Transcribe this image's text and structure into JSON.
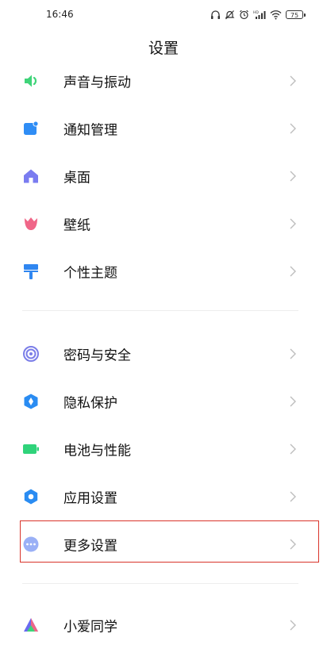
{
  "status_bar": {
    "time": "16:46",
    "battery_level": "75"
  },
  "page": {
    "title": "设置"
  },
  "groups": [
    [
      {
        "label": "声音与振动",
        "icon": "speaker-icon",
        "color": "#3fd479"
      },
      {
        "label": "通知管理",
        "icon": "notification-icon",
        "color": "#2f8df5"
      },
      {
        "label": "桌面",
        "icon": "home-icon",
        "color": "#7a7cf0"
      },
      {
        "label": "壁纸",
        "icon": "tulip-icon",
        "color": "#f06688"
      },
      {
        "label": "个性主题",
        "icon": "paint-roller-icon",
        "color": "#2f86f0"
      }
    ],
    [
      {
        "label": "密码与安全",
        "icon": "fingerprint-icon",
        "color": "#7b7ee8"
      },
      {
        "label": "隐私保护",
        "icon": "privacy-shield-icon",
        "color": "#2a8cf2"
      },
      {
        "label": "电池与性能",
        "icon": "battery-icon",
        "color": "#2fd37a"
      },
      {
        "label": "应用设置",
        "icon": "gear-icon",
        "color": "#2a8cf2"
      },
      {
        "label": "更多设置",
        "icon": "more-dots-icon",
        "color": "#9ab0f6"
      }
    ],
    [
      {
        "label": "小爱同学",
        "icon": "xiaoai-icon",
        "color": "#6a6af0"
      }
    ]
  ],
  "highlighted_item": "更多设置"
}
